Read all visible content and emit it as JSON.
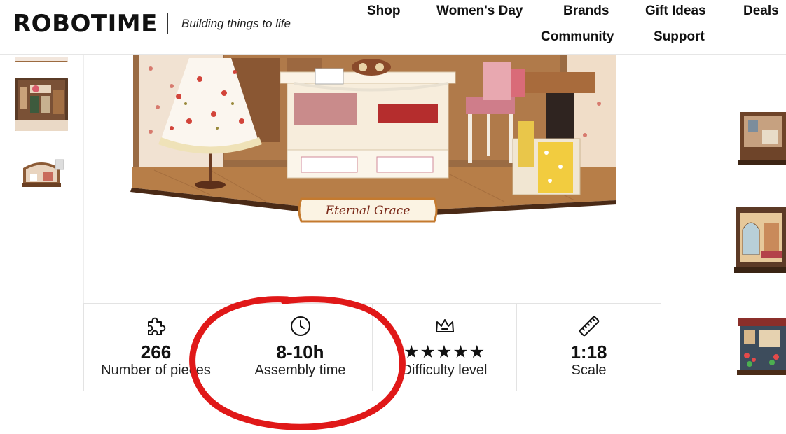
{
  "header": {
    "logo": "ROBOTIME",
    "tagline": "Building things to life",
    "nav": [
      "Shop",
      "Women's Day",
      "Brands",
      "Gift Ideas",
      "Deals",
      "Community",
      "Support"
    ]
  },
  "product": {
    "sign_text": "Eternal Grace"
  },
  "specs": [
    {
      "icon": "puzzle-icon",
      "value": "266",
      "label": "Number of pieces"
    },
    {
      "icon": "clock-icon",
      "value": "8-10h",
      "label": "Assembly time"
    },
    {
      "icon": "crown-icon",
      "value": "★★★★★",
      "label": "Difficulty level"
    },
    {
      "icon": "ruler-icon",
      "value": "1:18",
      "label": "Scale"
    }
  ],
  "colors": {
    "annotation": "#e01818",
    "wood": "#8a5a33",
    "floor": "#b07a45"
  }
}
